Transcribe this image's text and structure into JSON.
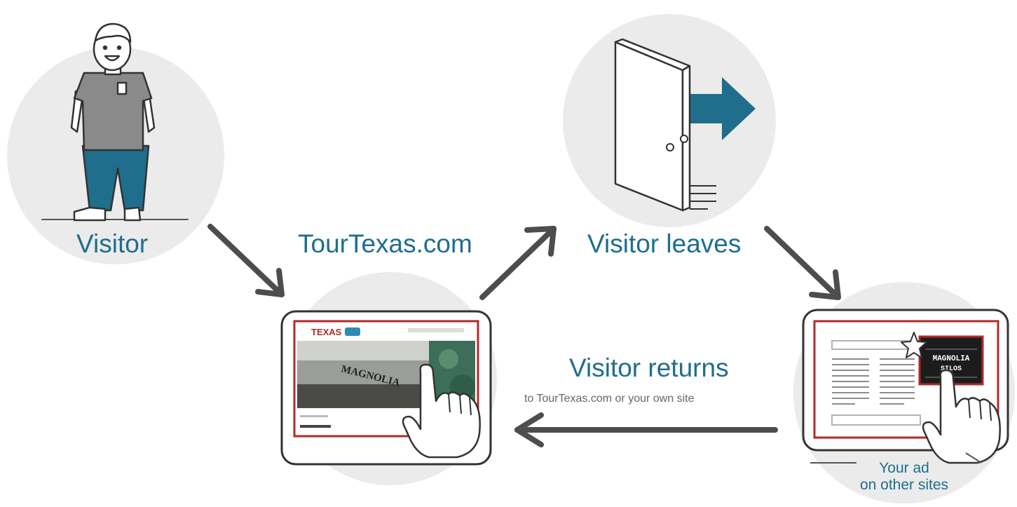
{
  "labels": {
    "visitor": "Visitor",
    "site": "TourTexas.com",
    "leaves": "Visitor leaves",
    "returns": "Visitor returns",
    "returns_sub": "to TourTexas.com or your own site",
    "ad_line1": "Your ad",
    "ad_line2": "on other sites"
  },
  "screens": {
    "site_logo": "TEXAS",
    "site_sign": "MAGNOLIA",
    "ad_sign_line1": "MAGNOLIA",
    "ad_sign_line2": "SILOS"
  },
  "colors": {
    "accent": "#1f6e8c",
    "circle": "#ebebec",
    "arrow": "#4d4d4d",
    "frame": "#b22a2a",
    "shirt": "#8a8a8a",
    "pants": "#1f6e8c"
  }
}
